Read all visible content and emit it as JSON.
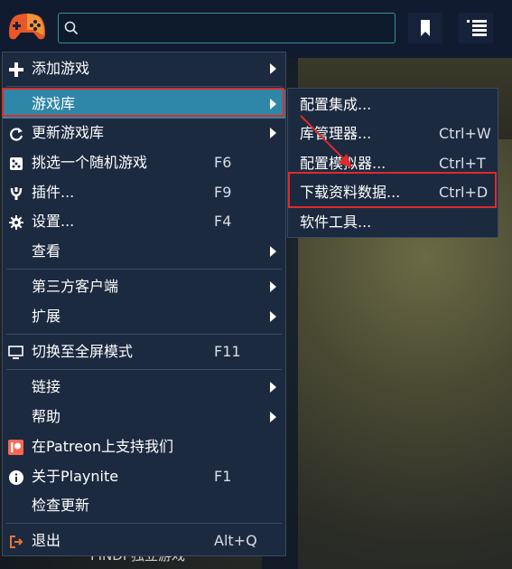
{
  "colors": {
    "accent": "#2f87a8",
    "menu_bg": "#1c2a40",
    "highlight_border": "#e02a2a",
    "search_border": "#3a8e9e"
  },
  "topbar": {
    "logo_icon": "gamepad-icon",
    "search": {
      "placeholder": "",
      "icon": "search-icon"
    },
    "buttons": [
      {
        "icon": "bookmark-icon"
      },
      {
        "icon": "list-view-icon"
      }
    ]
  },
  "menu": {
    "items": [
      {
        "label": "添加游戏",
        "icon": "plus-icon",
        "submenu": true
      },
      {
        "label": "游戏库",
        "submenu": true,
        "selected": true
      },
      {
        "label": "更新游戏库",
        "icon": "refresh-icon",
        "submenu": true
      },
      {
        "label": "挑选一个随机游戏",
        "icon": "dice-icon",
        "shortcut": "F6"
      },
      {
        "label": "插件...",
        "icon": "plugin-icon",
        "shortcut": "F9"
      },
      {
        "label": "设置...",
        "icon": "gear-icon",
        "shortcut": "F4"
      },
      {
        "label": "查看",
        "submenu": true
      },
      {
        "label": "第三方客户端",
        "submenu": true
      },
      {
        "label": "扩展",
        "submenu": true
      },
      {
        "label": "切换至全屏模式",
        "icon": "monitor-icon",
        "shortcut": "F11"
      },
      {
        "label": "链接",
        "submenu": true
      },
      {
        "label": "帮助",
        "submenu": true
      },
      {
        "label": "在Patreon上支持我们",
        "icon": "patreon-icon"
      },
      {
        "label": "关于Playnite",
        "icon": "info-icon",
        "shortcut": "F1"
      },
      {
        "label": "检查更新"
      },
      {
        "label": "退出",
        "icon": "exit-icon",
        "shortcut": "Alt+Q"
      }
    ]
  },
  "submenu": {
    "items": [
      {
        "label": "配置集成..."
      },
      {
        "label": "库管理器...",
        "shortcut": "Ctrl+W"
      },
      {
        "label": "配置模拟器...",
        "shortcut": "Ctrl+T"
      },
      {
        "label": "下载资料数据...",
        "shortcut": "Ctrl+D"
      },
      {
        "label": "软件工具..."
      }
    ]
  },
  "background": {
    "partial_text": "FINDI 独立游戏"
  }
}
